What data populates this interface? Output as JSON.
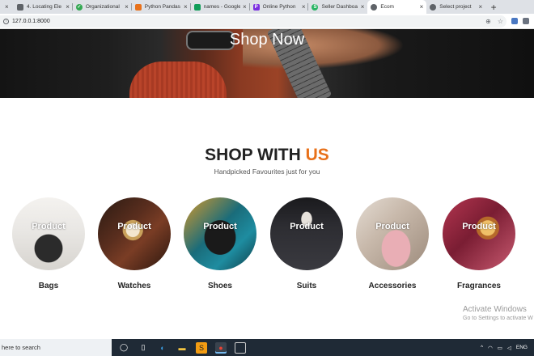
{
  "browser": {
    "tabs": [
      {
        "title": "",
        "favicon": "page-icon",
        "color": "#8a8a8a"
      },
      {
        "title": "4. Locating Ele",
        "favicon": "grid-icon",
        "color": "#5f6368"
      },
      {
        "title": "Organizational",
        "favicon": "check-icon",
        "color": "#34a853"
      },
      {
        "title": "Python Pandas",
        "favicon": "tools-icon",
        "color": "#e8711a"
      },
      {
        "title": "names - Google",
        "favicon": "sheets-icon",
        "color": "#0f9d58"
      },
      {
        "title": "Online Python",
        "favicon": "p-icon",
        "color": "#7b2fe0"
      },
      {
        "title": "Seller Dashboa",
        "favicon": "s-icon",
        "color": "#28b463"
      },
      {
        "title": "Ecom",
        "favicon": "globe-icon",
        "color": "#5f6368"
      },
      {
        "title": "Select project",
        "favicon": "globe-icon",
        "color": "#5f6368"
      }
    ],
    "new_tab": "+",
    "address": "127.0.0.1:8000"
  },
  "hero": {
    "title": "Shop Now"
  },
  "section": {
    "heading_main": "SHOP WITH ",
    "heading_accent": "US",
    "subtitle": "Handpicked Favourites just for you",
    "accent_color": "#e8711a"
  },
  "categories": [
    {
      "overlay": "Product",
      "name": "Bags"
    },
    {
      "overlay": "Product",
      "name": "Watches"
    },
    {
      "overlay": "Product",
      "name": "Shoes"
    },
    {
      "overlay": "Product",
      "name": "Suits"
    },
    {
      "overlay": "Product",
      "name": "Accessories"
    },
    {
      "overlay": "Product",
      "name": "Fragrances"
    }
  ],
  "watermark": {
    "line1": "Activate Windows",
    "line2": "Go to Settings to activate W"
  },
  "taskbar": {
    "search_placeholder": "here to search",
    "tray_lang": "ENG"
  }
}
